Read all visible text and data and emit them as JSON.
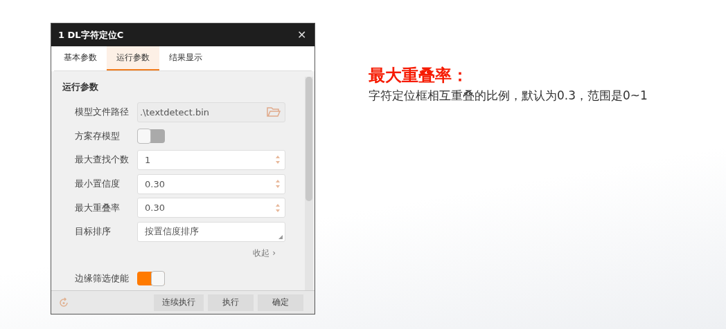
{
  "dialog": {
    "title": "1 DL字符定位C",
    "close": "✕",
    "tabs": [
      {
        "label": "基本参数",
        "selected": false
      },
      {
        "label": "运行参数",
        "selected": true
      },
      {
        "label": "结果显示",
        "selected": false
      }
    ],
    "section_title": "运行参数",
    "fields": [
      {
        "kind": "file",
        "label": "模型文件路径",
        "value": ".\\textdetect.bin"
      },
      {
        "kind": "toggle",
        "label": "方案存模型",
        "on": false
      },
      {
        "kind": "spinner",
        "label": "最大查找个数",
        "value": "1"
      },
      {
        "kind": "spinner",
        "label": "最小置信度",
        "value": "0.30"
      },
      {
        "kind": "spinner",
        "label": "最大重叠率",
        "value": "0.30"
      },
      {
        "kind": "dropdown",
        "label": "目标排序",
        "value": "按置信度排序"
      }
    ],
    "collapse_link": "收起 ›",
    "extra_fields": [
      {
        "kind": "toggle",
        "label": "边缘筛选使能",
        "on": true
      }
    ],
    "buttons": [
      "连续执行",
      "执行",
      "确定"
    ]
  },
  "note": {
    "heading": "最大重叠率：",
    "text": "字符定位框相互重叠的比例，默认为0.3，范围是0~1"
  }
}
